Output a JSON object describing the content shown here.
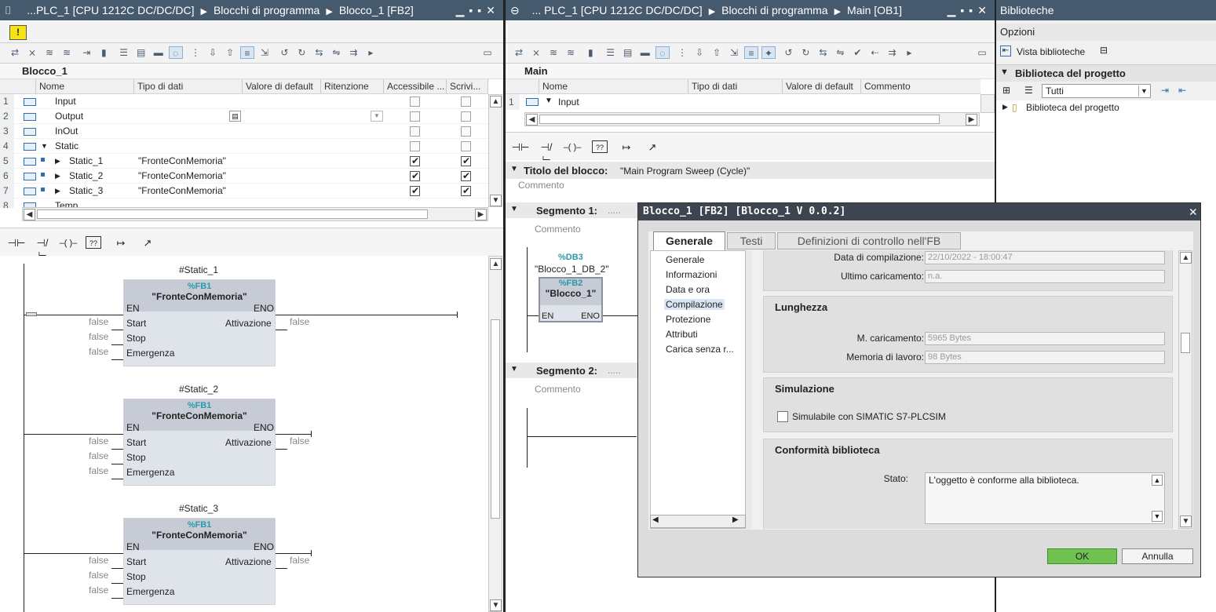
{
  "left": {
    "title": {
      "prefix": "...PLC_1 [CPU 1212C DC/DC/DC]",
      "mid": "Blocchi di programma",
      "end": "Blocco_1 [FB2]"
    },
    "block_name": "Blocco_1",
    "columns": [
      "Nome",
      "Tipo di dati",
      "Valore di default",
      "Ritenzione",
      "Accessibile ...",
      "Scrivi..."
    ],
    "rows": [
      {
        "n": "1",
        "name": "Input",
        "type": ""
      },
      {
        "n": "2",
        "name": "Output",
        "type": ""
      },
      {
        "n": "3",
        "name": "InOut",
        "type": ""
      },
      {
        "n": "4",
        "name": "Static",
        "type": ""
      },
      {
        "n": "5",
        "name": "Static_1",
        "type": "\"FronteConMemoria\""
      },
      {
        "n": "6",
        "name": "Static_2",
        "type": "\"FronteConMemoria\""
      },
      {
        "n": "7",
        "name": "Static_3",
        "type": "\"FronteConMemoria\""
      },
      {
        "n": "8",
        "name": "Temp",
        "type": ""
      }
    ],
    "networks": [
      {
        "inst": "#Static_1",
        "fb": "%FB1",
        "fbname": "\"FronteConMemoria\""
      },
      {
        "inst": "#Static_2",
        "fb": "%FB1",
        "fbname": "\"FronteConMemoria\""
      },
      {
        "inst": "#Static_3",
        "fb": "%FB1",
        "fbname": "\"FronteConMemoria\""
      }
    ],
    "pins": {
      "en": "EN",
      "eno": "ENO",
      "start": "Start",
      "stop": "Stop",
      "emerg": "Emergenza",
      "att": "Attivazione",
      "false": "false"
    }
  },
  "mid": {
    "title": {
      "prefix": "... PLC_1 [CPU 1212C DC/DC/DC]",
      "mid": "Blocchi di programma",
      "end": "Main [OB1]"
    },
    "block_name": "Main",
    "columns": [
      "Nome",
      "Tipo di dati",
      "Valore di default",
      "Commento"
    ],
    "row1": {
      "n": "1",
      "name": "Input"
    },
    "block_title_label": "Titolo del blocco:",
    "block_title_value": "\"Main Program Sweep (Cycle)\"",
    "comment": "Commento",
    "seg1": "Segmento 1:",
    "seg2": "Segmento 2:",
    "seg_dots": ".....",
    "db": "%DB3",
    "dbname": "\"Blocco_1_DB_2\"",
    "fb": "%FB2",
    "fbname": "\"Blocco_1\"",
    "en": "EN",
    "eno": "ENO"
  },
  "right": {
    "title": "Biblioteche",
    "options": "Opzioni",
    "view_lib": "Vista biblioteche",
    "project_lib": "Biblioteca del progetto",
    "filter": "Tutti",
    "tree_item": "Biblioteca del progetto"
  },
  "dialog": {
    "title": "Blocco_1 [FB2] [Blocco_1 V 0.0.2]",
    "tabs": [
      "Generale",
      "Testi",
      "Definizioni di controllo nell'FB"
    ],
    "nav": [
      "Generale",
      "Informazioni",
      "Data e ora",
      "Compilazione",
      "Protezione",
      "Attributi",
      "Carica senza r..."
    ],
    "compile_date_label": "Data di compilazione:",
    "compile_date": "22/10/2022 - 18:00:47",
    "last_load_label": "Ultimo caricamento:",
    "last_load": "n.a.",
    "length_title": "Lunghezza",
    "load_mem_label": "M. caricamento:",
    "load_mem": "5965 Bytes",
    "work_mem_label": "Memoria di lavoro:",
    "work_mem": "98 Bytes",
    "sim_title": "Simulazione",
    "sim_check": "Simulabile con SIMATIC S7-PLCSIM",
    "conf_title": "Conformità biblioteca",
    "state_label": "Stato:",
    "state": "L'oggetto è conforme alla biblioteca.",
    "ok": "OK",
    "cancel": "Annulla"
  },
  "ladder_palette": [
    "⊣⊢",
    "⊣/⊢",
    "–( )–",
    "??",
    "↦",
    "↗"
  ]
}
